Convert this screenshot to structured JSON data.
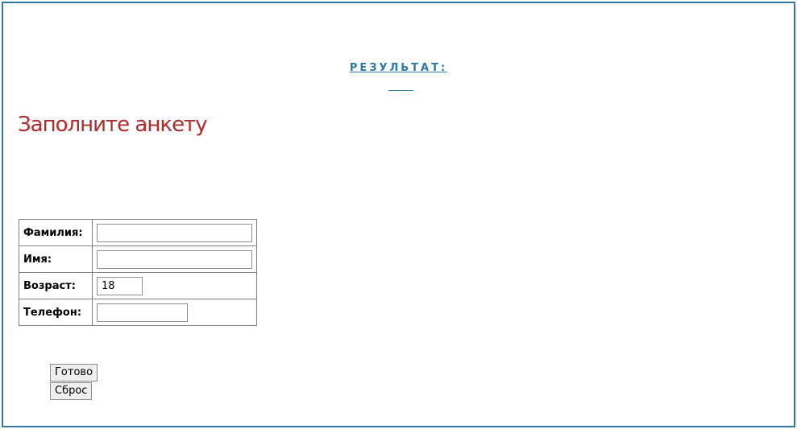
{
  "result": {
    "link_text": "РЕЗУЛЬТАТ:",
    "value": ""
  },
  "heading": "Заполните анкету",
  "form": {
    "fields": [
      {
        "label": "Фамилия:",
        "value": "",
        "placeholder": ""
      },
      {
        "label": "Имя:",
        "value": "",
        "placeholder": ""
      },
      {
        "label": "Возраст:",
        "value": "18",
        "placeholder": ""
      },
      {
        "label": "Телефон:",
        "value": "",
        "placeholder": ""
      }
    ],
    "submit_label": "Готово",
    "reset_label": "Сброс"
  },
  "colors": {
    "frame_border": "#2f7aa5",
    "link": "#2f7aa5",
    "heading": "#b22a2a"
  }
}
